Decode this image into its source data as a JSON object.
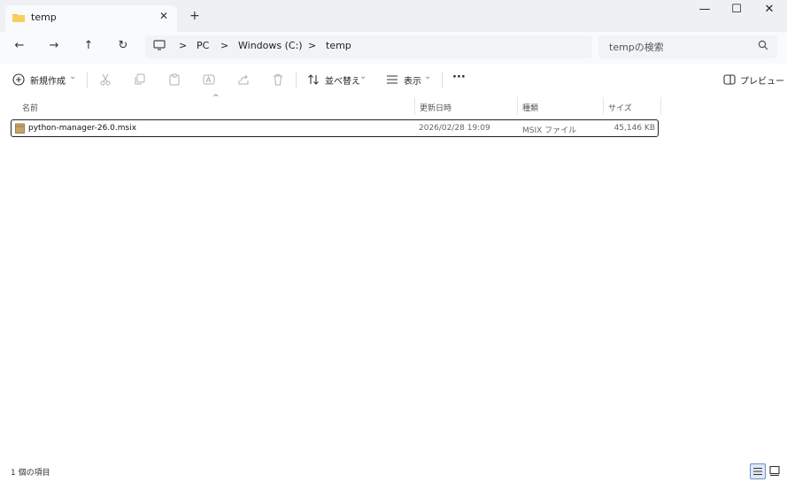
{
  "tab": {
    "title": "temp",
    "close": "✕",
    "new_tab": "+"
  },
  "window_controls": {
    "minimize": "—",
    "maximize": "☐",
    "close": "✕"
  },
  "nav": {
    "back": "←",
    "forward": "→",
    "up": "↑",
    "refresh": "↻"
  },
  "breadcrumb": {
    "sep": ">",
    "items": [
      "PC",
      "Windows (C:)",
      "temp"
    ]
  },
  "search": {
    "placeholder": "tempの検索"
  },
  "toolbar": {
    "new_label": "新規作成",
    "new_chevron": "⌄",
    "sort_label": "並べ替え",
    "sort_chevron": "⌄",
    "view_label": "表示",
    "view_chevron": "⌄",
    "more": "···",
    "preview_label": "プレビュー"
  },
  "columns": {
    "name": "名前",
    "modified": "更新日時",
    "type": "種類",
    "size": "サイズ",
    "sort_indicator": "^"
  },
  "files": [
    {
      "name": "python-manager-26.0.msix",
      "modified": "2026/02/28 19:09",
      "type": "MSIX ファイル",
      "size": "45,146 KB"
    }
  ],
  "status": {
    "count": "1 個の項目"
  }
}
